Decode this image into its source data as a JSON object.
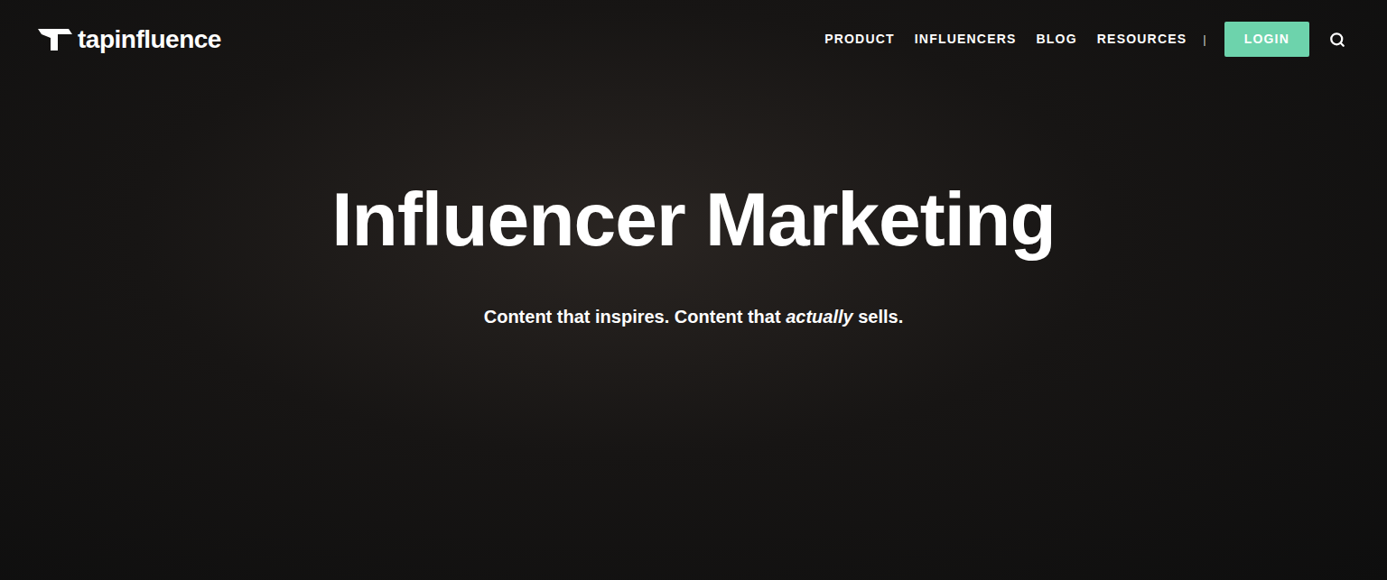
{
  "logo": {
    "text": "tapinfluence"
  },
  "nav": {
    "items": [
      {
        "label": "PRODUCT"
      },
      {
        "label": "INFLUENCERS"
      },
      {
        "label": "BLOG"
      },
      {
        "label": "RESOURCES"
      }
    ],
    "separator": "|",
    "login": {
      "label": "LOGIN"
    }
  },
  "hero": {
    "title": "Influencer Marketing",
    "subtitle": [
      {
        "text": "Content that inspires. Content that ",
        "italic": false
      },
      {
        "text": "actually",
        "italic": true
      },
      {
        "text": " sells.",
        "italic": false
      }
    ]
  }
}
